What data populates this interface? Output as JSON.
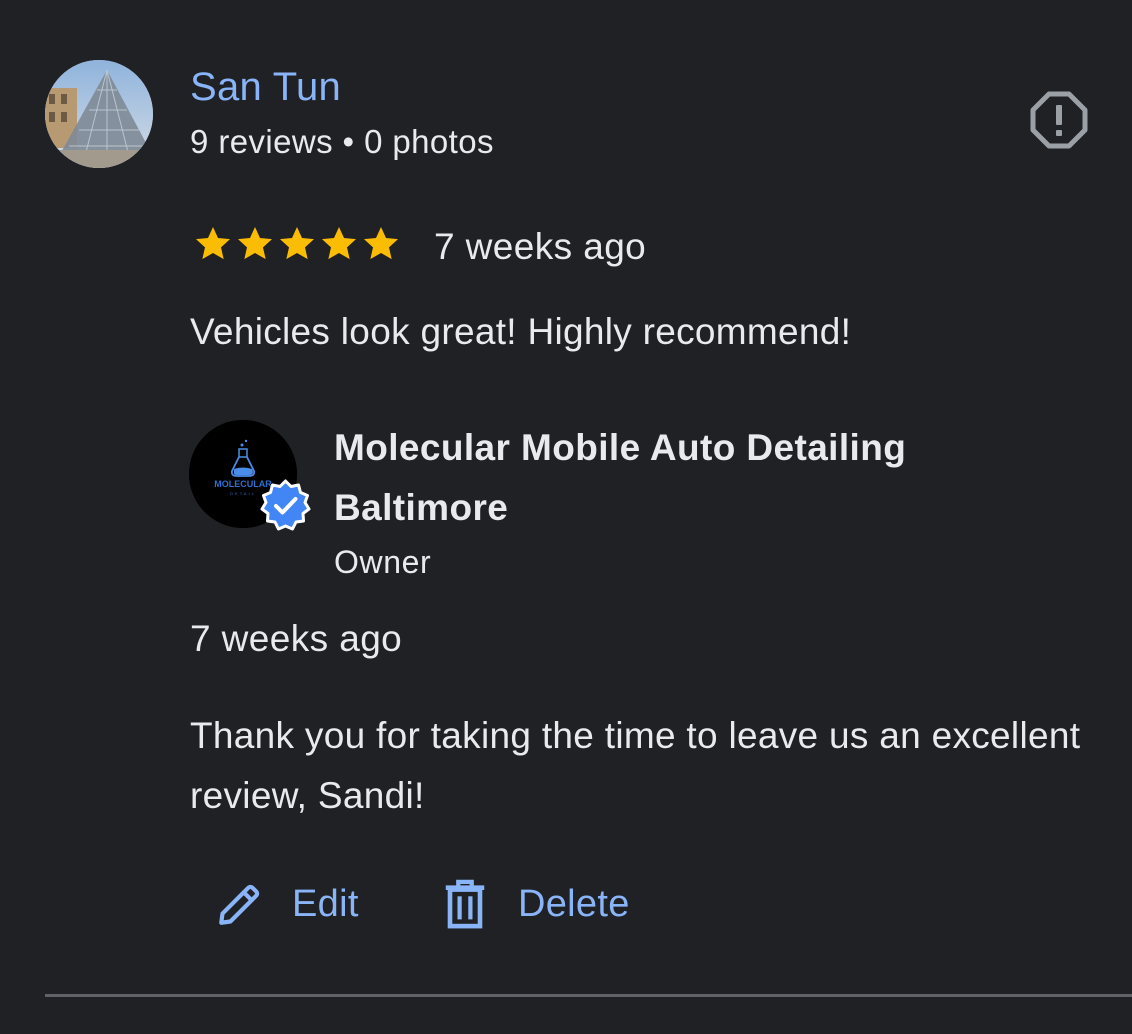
{
  "review": {
    "reviewer_name": "San Tun",
    "reviewer_meta": "9 reviews • 0 photos",
    "rating": 5,
    "max_rating": 5,
    "date": "7 weeks ago",
    "text": "Vehicles look great! Highly recommend!"
  },
  "owner_response": {
    "business_name": "Molecular Mobile Auto Detailing Baltimore",
    "logo_text": "MOLECULAR",
    "role": "Owner",
    "date": "7 weeks ago",
    "text": "Thank you for taking the time to leave us an excellent review, Sandi!"
  },
  "actions": {
    "edit_label": "Edit",
    "delete_label": "Delete"
  },
  "colors": {
    "background": "#202124",
    "link": "#8ab4f8",
    "text": "#e8eaed",
    "star": "#fbbc04",
    "verified": "#4285f4",
    "icon_gray": "#9aa0a6"
  },
  "icons": {
    "report": "report-flag-icon",
    "edit": "pencil-icon",
    "delete": "trash-icon",
    "verified": "verified-check-icon",
    "star": "star-icon"
  }
}
